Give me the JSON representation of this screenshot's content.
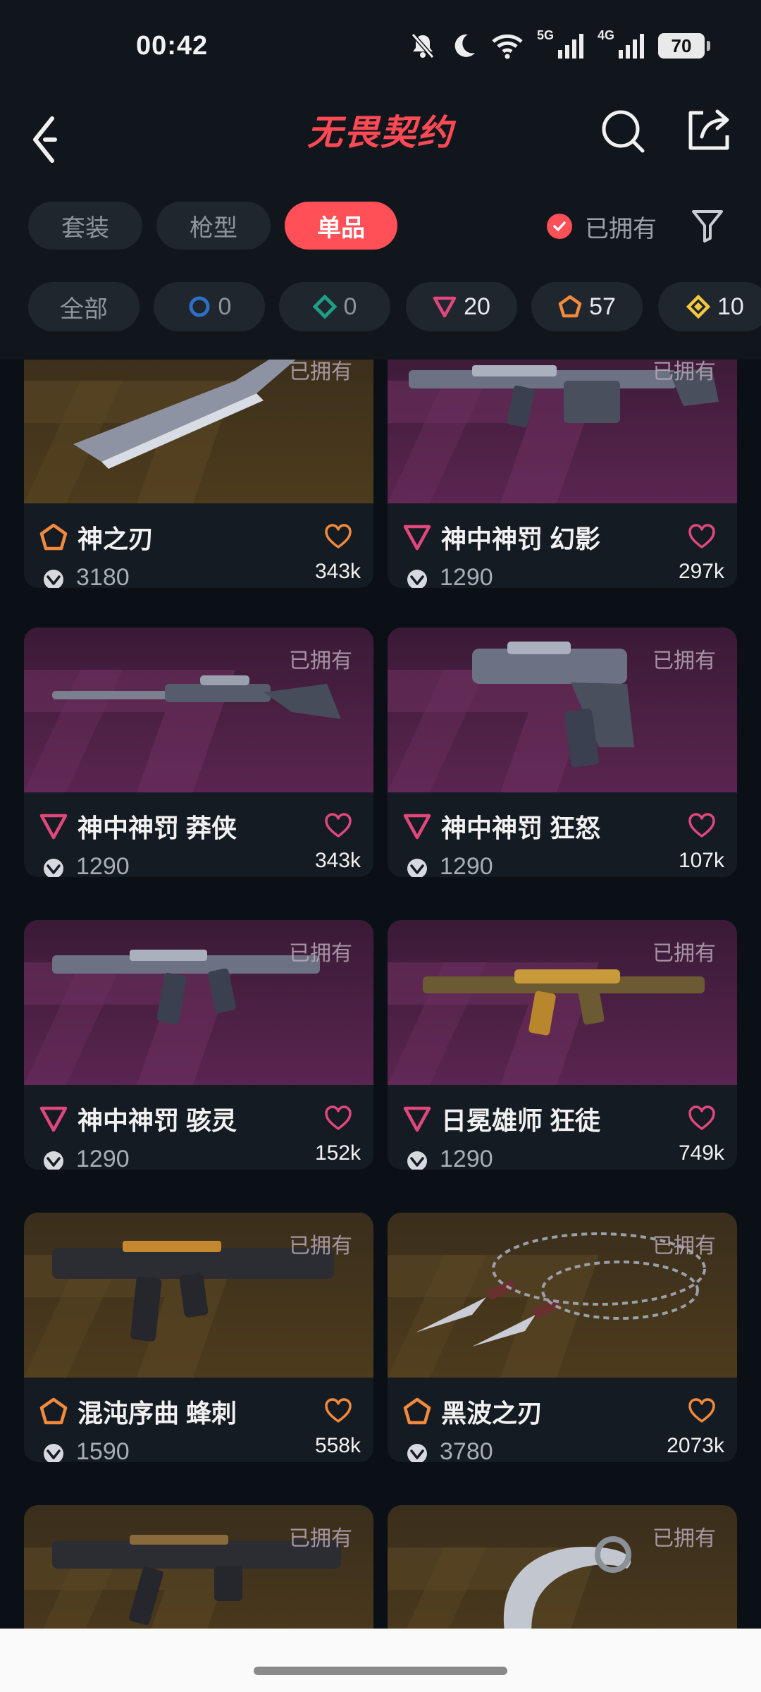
{
  "status_bar": {
    "time": "00:42",
    "net1": "5G",
    "net2": "4G",
    "battery": "70"
  },
  "header": {
    "title": "无畏契约"
  },
  "tabs": [
    {
      "label": "套装",
      "active": false
    },
    {
      "label": "枪型",
      "active": false
    },
    {
      "label": "单品",
      "active": true
    }
  ],
  "owned_filter": {
    "label": "已拥有",
    "checked": true
  },
  "rarity_chips": [
    {
      "label": "全部"
    },
    {
      "count": "0",
      "color": "#2d6fc4"
    },
    {
      "count": "0",
      "color": "#1f9e86"
    },
    {
      "count": "20",
      "color": "#e0487d"
    },
    {
      "count": "57",
      "color": "#f28a3c"
    },
    {
      "count": "10",
      "color": "#f5c842"
    }
  ],
  "skins": [
    {
      "name": "神之刃",
      "price": "3180",
      "favs": "343k",
      "owned": "已拥有",
      "rarity": "exclusive",
      "color": "#f28a3c",
      "bg": "gold"
    },
    {
      "name": "神中神罚 幻影",
      "price": "1290",
      "favs": "297k",
      "owned": "已拥有",
      "rarity": "premium",
      "color": "#e0487d",
      "bg": "purple"
    },
    {
      "name": "神中神罚 莽侠",
      "price": "1290",
      "favs": "343k",
      "owned": "已拥有",
      "rarity": "premium",
      "color": "#e0487d",
      "bg": "purple"
    },
    {
      "name": "神中神罚 狂怒",
      "price": "1290",
      "favs": "107k",
      "owned": "已拥有",
      "rarity": "premium",
      "color": "#e0487d",
      "bg": "purple"
    },
    {
      "name": "神中神罚 骇灵",
      "price": "1290",
      "favs": "152k",
      "owned": "已拥有",
      "rarity": "premium",
      "color": "#e0487d",
      "bg": "purple"
    },
    {
      "name": "日冕雄师 狂徒",
      "price": "1290",
      "favs": "749k",
      "owned": "已拥有",
      "rarity": "premium",
      "color": "#e0487d",
      "bg": "purple"
    },
    {
      "name": "混沌序曲 蜂刺",
      "price": "1590",
      "favs": "558k",
      "owned": "已拥有",
      "rarity": "exclusive",
      "color": "#f28a3c",
      "bg": "gold"
    },
    {
      "name": "黑波之刃",
      "price": "3780",
      "favs": "2073k",
      "owned": "已拥有",
      "rarity": "exclusive",
      "color": "#f28a3c",
      "bg": "gold"
    },
    {
      "name": "",
      "price": "",
      "favs": "",
      "owned": "已拥有",
      "rarity": "exclusive",
      "color": "#f28a3c",
      "bg": "gold"
    },
    {
      "name": "",
      "price": "",
      "favs": "",
      "owned": "已拥有",
      "rarity": "exclusive",
      "color": "#f28a3c",
      "bg": "gold"
    }
  ]
}
